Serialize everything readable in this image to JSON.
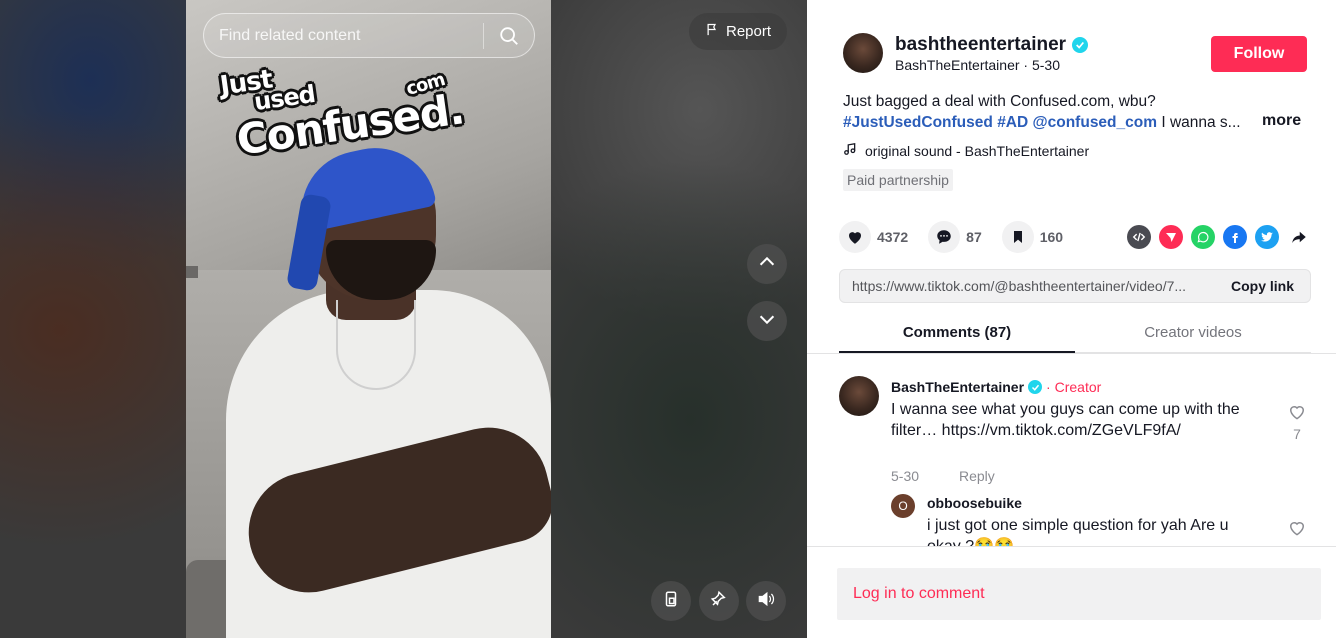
{
  "search": {
    "placeholder": "Find related content"
  },
  "report": {
    "label": "Report"
  },
  "sticker": {
    "line1": "Just",
    "line2": "used",
    "line3": "Confused.",
    "line4": "com"
  },
  "author": {
    "username": "bashtheentertainer",
    "display_name": "BashTheEntertainer",
    "date": "5-30",
    "follow_label": "Follow"
  },
  "caption": {
    "text": "Just bagged a deal with Confused.com, wbu?",
    "hashtag1": "#JustUsedConfused",
    "hashtag2": "#AD",
    "mention": "@confused_com",
    "truncated": "I wanna s...",
    "more_label": "more"
  },
  "sound": {
    "label": "original sound - BashTheEntertainer"
  },
  "paid_partnership": "Paid partnership",
  "stats": {
    "likes": "4372",
    "comments": "87",
    "saves": "160"
  },
  "share_icons": [
    "embed-icon",
    "send-icon",
    "whatsapp-icon",
    "facebook-icon",
    "twitter-icon",
    "share-arrow-icon"
  ],
  "link": {
    "url": "https://www.tiktok.com/@bashtheentertainer/video/7...",
    "copy_label": "Copy link"
  },
  "tabs": [
    {
      "label": "Comments (87)",
      "active": true
    },
    {
      "label": "Creator videos",
      "active": false
    }
  ],
  "comments": [
    {
      "user": "BashTheEntertainer",
      "badge": "· Creator",
      "text": "I wanna see what you guys can come up with the filter… https://vm.tiktok.com/ZGeVLF9fA/",
      "date": "5-30",
      "reply_label": "Reply",
      "likes": "7",
      "reply": {
        "avatar_letter": "O",
        "user": "obboosebuike",
        "text": "i just got one simple question for yah Are u okay ?😭😭"
      }
    }
  ],
  "login": {
    "label": "Log in to comment"
  },
  "colors": {
    "brand_red": "#fe2c55",
    "verified": "#20d5ec",
    "hashtag": "#2b5db9"
  }
}
